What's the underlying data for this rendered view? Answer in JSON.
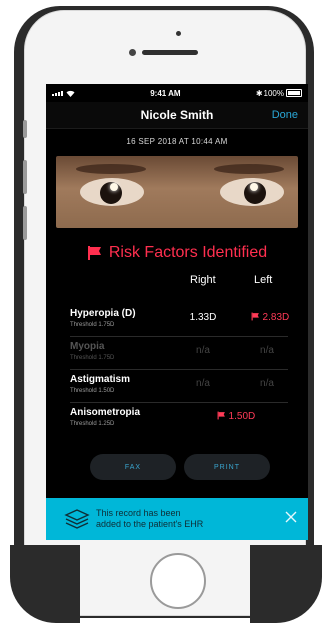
{
  "status_bar": {
    "time": "9:41 AM",
    "battery": "100%"
  },
  "nav": {
    "title": "Nicole Smith",
    "done_label": "Done"
  },
  "timestamp": "16 SEP 2018 AT 10:44 AM",
  "banner": {
    "title": "Risk Factors Identified",
    "color": "#ff2f4f"
  },
  "columns": {
    "right": "Right",
    "left": "Left"
  },
  "rows": [
    {
      "name": "Hyperopia (D)",
      "threshold": "Threshold 1.75D",
      "right": "1.33D",
      "left": "2.83D"
    },
    {
      "name": "Myopia",
      "threshold": "Threshold 1.75D",
      "right": "n/a",
      "left": "n/a"
    },
    {
      "name": "Astigmatism",
      "threshold": "Threshold 1.50D",
      "right": "n/a",
      "left": "n/a"
    },
    {
      "name": "Anisometropia",
      "threshold": "Threshold 1.25D",
      "combined": "1.50D"
    }
  ],
  "buttons": {
    "fax": "FAX",
    "print": "PRINT"
  },
  "toast": {
    "line1": "This record has been",
    "line2": "added to the patient's EHR",
    "color": "#00b7d8"
  },
  "icons": [
    "signal-icon",
    "wifi-icon",
    "bluetooth-icon",
    "battery-icon",
    "flag-icon",
    "records-stack-icon",
    "close-icon"
  ]
}
